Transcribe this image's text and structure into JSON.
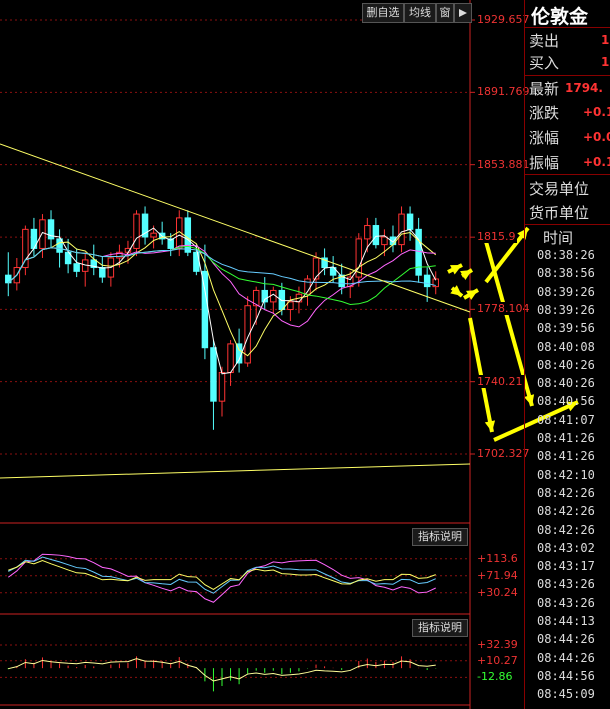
{
  "toolbar": {
    "delete_label": "删自选",
    "ma_label": "均线",
    "window_label": "窗",
    "nav_icon": "triangle-right-icon"
  },
  "panel": {
    "title": "伦敦金",
    "sell_label": "卖出",
    "sell_value": "1",
    "buy_label": "买入",
    "buy_value": "1",
    "last_label": "最新",
    "last_value": "1794.",
    "change_label": "涨跌",
    "change_value": "+0.1",
    "change_pct_label": "涨幅",
    "change_pct_value": "+0.0",
    "amplitude_label": "振幅",
    "amplitude_value": "+0.1",
    "trade_unit_label": "交易单位",
    "currency_unit_label": "货币单位",
    "time_header": "时间",
    "times": [
      "08:38:26",
      "08:38:56",
      "08:39:26",
      "08:39:26",
      "08:39:56",
      "08:40:08",
      "08:40:26",
      "08:40:26",
      "08:40:56",
      "08:41:07",
      "08:41:26",
      "08:41:26",
      "08:42:10",
      "08:42:26",
      "08:42:26",
      "08:42:26",
      "08:43:02",
      "08:43:17",
      "08:43:26",
      "08:43:26",
      "08:44:13",
      "08:44:26",
      "08:44:26",
      "08:44:56",
      "08:45:09"
    ]
  },
  "indicator_button": "指标说明",
  "indicator_button_2": "指标说明",
  "colors": {
    "up": "#ff3333",
    "down": "#54ffff",
    "axis": "#e33333",
    "annotation": "#ffff00"
  },
  "chart_data": [
    {
      "type": "candlestick",
      "y_ticks": [
        "1929.657",
        "1891.769",
        "1853.881",
        "1815.9",
        "1778.104",
        "1740.21",
        "1702.327"
      ],
      "ylim": [
        1702.327,
        1929.657
      ],
      "candles": [
        {
          "o": 1796,
          "h": 1808,
          "l": 1785,
          "c": 1792
        },
        {
          "o": 1792,
          "h": 1805,
          "l": 1788,
          "c": 1800
        },
        {
          "o": 1800,
          "h": 1822,
          "l": 1796,
          "c": 1820
        },
        {
          "o": 1820,
          "h": 1826,
          "l": 1806,
          "c": 1810
        },
        {
          "o": 1810,
          "h": 1828,
          "l": 1805,
          "c": 1825
        },
        {
          "o": 1825,
          "h": 1830,
          "l": 1810,
          "c": 1815
        },
        {
          "o": 1815,
          "h": 1820,
          "l": 1800,
          "c": 1808
        },
        {
          "o": 1808,
          "h": 1815,
          "l": 1797,
          "c": 1802
        },
        {
          "o": 1802,
          "h": 1810,
          "l": 1795,
          "c": 1798
        },
        {
          "o": 1798,
          "h": 1808,
          "l": 1790,
          "c": 1804
        },
        {
          "o": 1804,
          "h": 1812,
          "l": 1796,
          "c": 1800
        },
        {
          "o": 1800,
          "h": 1806,
          "l": 1792,
          "c": 1795
        },
        {
          "o": 1795,
          "h": 1808,
          "l": 1790,
          "c": 1805
        },
        {
          "o": 1805,
          "h": 1812,
          "l": 1800,
          "c": 1808
        },
        {
          "o": 1808,
          "h": 1814,
          "l": 1802,
          "c": 1810
        },
        {
          "o": 1810,
          "h": 1830,
          "l": 1806,
          "c": 1828
        },
        {
          "o": 1828,
          "h": 1832,
          "l": 1812,
          "c": 1816
        },
        {
          "o": 1816,
          "h": 1822,
          "l": 1810,
          "c": 1818
        },
        {
          "o": 1818,
          "h": 1824,
          "l": 1812,
          "c": 1815
        },
        {
          "o": 1815,
          "h": 1818,
          "l": 1806,
          "c": 1810
        },
        {
          "o": 1810,
          "h": 1830,
          "l": 1806,
          "c": 1826
        },
        {
          "o": 1826,
          "h": 1830,
          "l": 1806,
          "c": 1808
        },
        {
          "o": 1808,
          "h": 1812,
          "l": 1796,
          "c": 1798
        },
        {
          "o": 1798,
          "h": 1812,
          "l": 1752,
          "c": 1758
        },
        {
          "o": 1758,
          "h": 1762,
          "l": 1715,
          "c": 1730
        },
        {
          "o": 1730,
          "h": 1748,
          "l": 1722,
          "c": 1745
        },
        {
          "o": 1745,
          "h": 1762,
          "l": 1738,
          "c": 1760
        },
        {
          "o": 1760,
          "h": 1768,
          "l": 1745,
          "c": 1750
        },
        {
          "o": 1750,
          "h": 1785,
          "l": 1748,
          "c": 1780
        },
        {
          "o": 1780,
          "h": 1790,
          "l": 1770,
          "c": 1788
        },
        {
          "o": 1788,
          "h": 1795,
          "l": 1778,
          "c": 1782
        },
        {
          "o": 1782,
          "h": 1790,
          "l": 1776,
          "c": 1788
        },
        {
          "o": 1788,
          "h": 1792,
          "l": 1775,
          "c": 1778
        },
        {
          "o": 1778,
          "h": 1785,
          "l": 1772,
          "c": 1782
        },
        {
          "o": 1782,
          "h": 1790,
          "l": 1776,
          "c": 1786
        },
        {
          "o": 1786,
          "h": 1796,
          "l": 1780,
          "c": 1794
        },
        {
          "o": 1794,
          "h": 1808,
          "l": 1788,
          "c": 1805
        },
        {
          "o": 1805,
          "h": 1810,
          "l": 1796,
          "c": 1800
        },
        {
          "o": 1800,
          "h": 1806,
          "l": 1792,
          "c": 1796
        },
        {
          "o": 1796,
          "h": 1802,
          "l": 1786,
          "c": 1790
        },
        {
          "o": 1790,
          "h": 1798,
          "l": 1784,
          "c": 1795
        },
        {
          "o": 1795,
          "h": 1818,
          "l": 1790,
          "c": 1815
        },
        {
          "o": 1815,
          "h": 1826,
          "l": 1808,
          "c": 1822
        },
        {
          "o": 1822,
          "h": 1826,
          "l": 1810,
          "c": 1812
        },
        {
          "o": 1812,
          "h": 1820,
          "l": 1806,
          "c": 1816
        },
        {
          "o": 1816,
          "h": 1822,
          "l": 1808,
          "c": 1812
        },
        {
          "o": 1812,
          "h": 1832,
          "l": 1808,
          "c": 1828
        },
        {
          "o": 1828,
          "h": 1832,
          "l": 1814,
          "c": 1820
        },
        {
          "o": 1820,
          "h": 1826,
          "l": 1792,
          "c": 1796
        },
        {
          "o": 1796,
          "h": 1800,
          "l": 1782,
          "c": 1790
        },
        {
          "o": 1790,
          "h": 1798,
          "l": 1786,
          "c": 1794
        }
      ]
    },
    {
      "type": "line",
      "y_ticks": [
        "+113.6",
        "+71.94",
        "+30.24"
      ],
      "ylim": [
        0,
        140
      ]
    },
    {
      "type": "bar",
      "y_ticks": [
        "+32.39",
        "+10.27",
        "-12.86"
      ],
      "ylim": [
        -25,
        45
      ]
    }
  ]
}
